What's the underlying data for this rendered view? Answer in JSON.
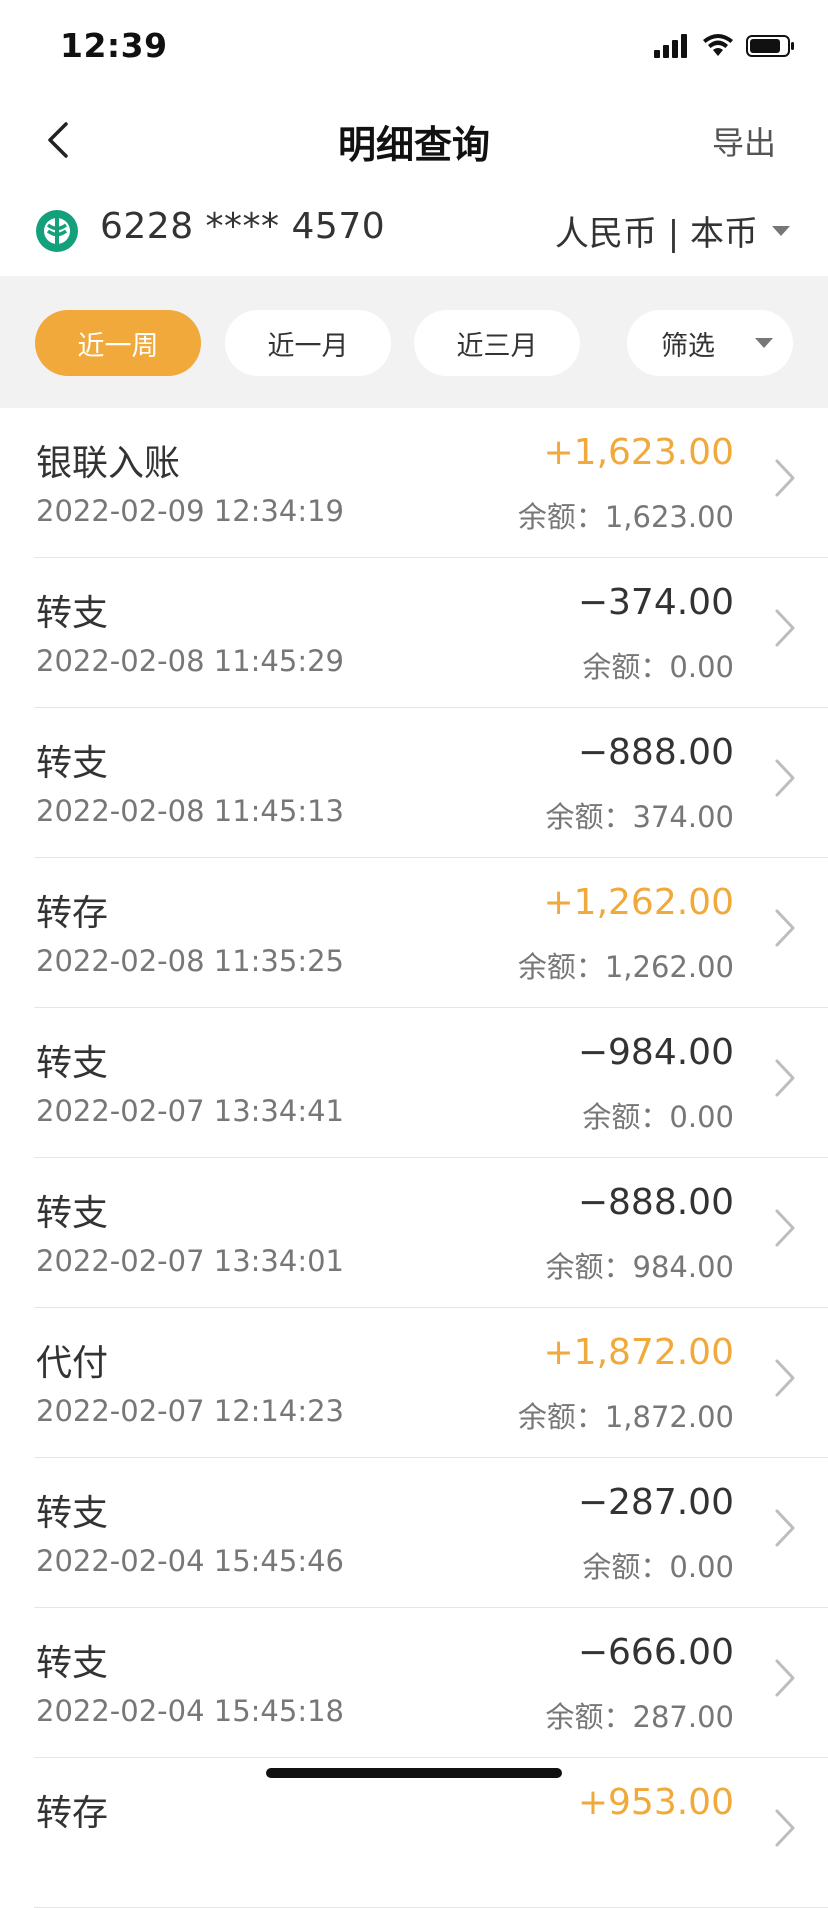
{
  "status": {
    "time": "12:39"
  },
  "nav": {
    "title": "明细查询",
    "export_label": "导出"
  },
  "account": {
    "card_number": "6228 **** 4570",
    "currency": "人民币 | 本币"
  },
  "filters": {
    "week": "近一周",
    "month": "近一月",
    "three_months": "近三月",
    "filter": "筛选"
  },
  "colors": {
    "accent": "#f0a93a",
    "bank_green": "#13a07a"
  },
  "balance_prefix": "余额：",
  "transactions": [
    {
      "title": "银联入账",
      "time": "2022-02-09 12:34:19",
      "amount": "+1,623.00",
      "balance": "1,623.00"
    },
    {
      "title": "转支",
      "time": "2022-02-08 11:45:29",
      "amount": "−374.00",
      "balance": "0.00"
    },
    {
      "title": "转支",
      "time": "2022-02-08 11:45:13",
      "amount": "−888.00",
      "balance": "374.00"
    },
    {
      "title": "转存",
      "time": "2022-02-08 11:35:25",
      "amount": "+1,262.00",
      "balance": "1,262.00"
    },
    {
      "title": "转支",
      "time": "2022-02-07 13:34:41",
      "amount": "−984.00",
      "balance": "0.00"
    },
    {
      "title": "转支",
      "time": "2022-02-07 13:34:01",
      "amount": "−888.00",
      "balance": "984.00"
    },
    {
      "title": "代付",
      "time": "2022-02-07 12:14:23",
      "amount": "+1,872.00",
      "balance": "1,872.00"
    },
    {
      "title": "转支",
      "time": "2022-02-04 15:45:46",
      "amount": "−287.00",
      "balance": "0.00"
    },
    {
      "title": "转支",
      "time": "2022-02-04 15:45:18",
      "amount": "−666.00",
      "balance": "287.00"
    },
    {
      "title": "转存",
      "time": "",
      "amount": "+953.00",
      "balance": ""
    }
  ]
}
